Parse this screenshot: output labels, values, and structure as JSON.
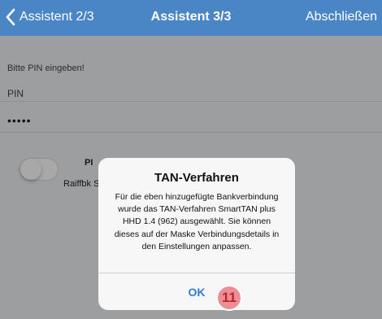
{
  "navbar": {
    "back_label": "Assistent 2/3",
    "title": "Assistent 3/3",
    "finish_label": "Abschließen",
    "color": "#4a86c6"
  },
  "form": {
    "prompt": "Bitte PIN eingeben!",
    "pin_label": "PIN",
    "pin_value": "•••••",
    "toggle_label": "PI",
    "toggle_sublabel": "Raiffbk S",
    "toggle_on": false
  },
  "alert": {
    "title": "TAN-Verfahren",
    "message": "Für die eben hinzugefügte Bankverbindung wurde das TAN-Verfahren SmartTAN plus HHD 1.4 (962) ausgewählt. Sie können dieses auf der Maske Verbindungsdetails in den Einstellungen anpassen.",
    "ok_label": "OK",
    "accent": "#3478d6"
  },
  "annotation": {
    "step_number": "11"
  }
}
